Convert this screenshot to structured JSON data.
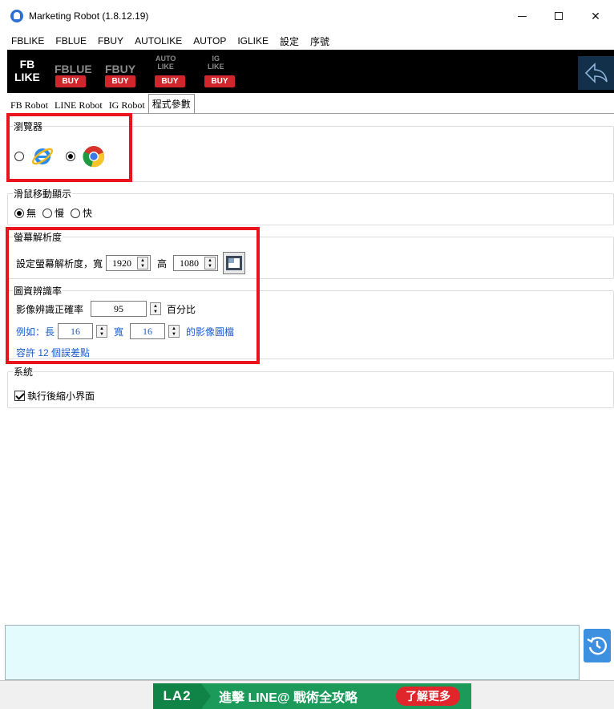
{
  "window": {
    "title": "Marketing Robot (1.8.12.19)"
  },
  "menu": [
    "FBLIKE",
    "FBLUE",
    "FBUY",
    "AUTOLIKE",
    "AUTOP",
    "IGLIKE",
    "設定",
    "序號"
  ],
  "banner": {
    "fb_line1": "FB",
    "fb_line2": "LIKE",
    "fblue": "FBLUE",
    "fbuy": "FBUY",
    "auto_1": "AUTO",
    "auto_2": "LIKE",
    "ig_1": "IG",
    "ig_2": "LIKE",
    "buy": "BUY"
  },
  "tabs": [
    "FB Robot",
    "LINE Robot",
    "IG Robot",
    "程式參數"
  ],
  "browser": {
    "legend": "瀏覽器",
    "options": [
      "ie-icon",
      "chrome-icon"
    ],
    "selected_index": 1
  },
  "mouse": {
    "legend": "滑鼠移動顯示",
    "options": [
      "無",
      "慢",
      "快"
    ],
    "selected_index": 0
  },
  "resolution": {
    "legend": "螢幕解析度",
    "label": "設定螢幕解析度，寬",
    "width": "1920",
    "height_label": "高",
    "height": "1080"
  },
  "recognition": {
    "legend": "圖資辨識率",
    "accuracy_label": "影像辨識正確率",
    "accuracy": "95",
    "percent_label": "百分比",
    "example_label": "例如：長",
    "length": "16",
    "width_label": "寬",
    "width": "16",
    "suffix": "的影像圖檔",
    "tolerance": "容許 12 個誤差點"
  },
  "system": {
    "legend": "系統",
    "minimize_label": "執行後縮小界面",
    "minimize_checked": true
  },
  "ad": {
    "brand": "LA2",
    "message": "進擊 LINE@ 戰術全攻略",
    "cta": "了解更多"
  },
  "colors": {
    "highlight": "#e8131b",
    "log_background": "#e3fbfd",
    "ad_green": "#1b9a5a",
    "link_blue": "#1a5ccc"
  }
}
